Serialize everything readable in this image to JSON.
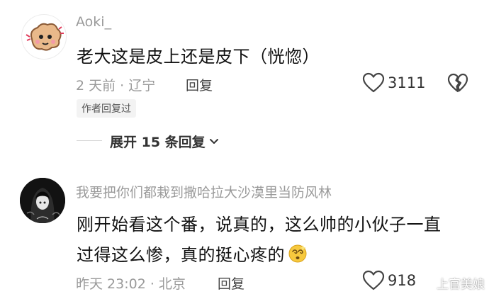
{
  "comments": [
    {
      "username": "Aoki_",
      "content": "老大这是皮上还是皮下（恍惚）",
      "time_location": "2 天前 · 辽宁",
      "reply_label": "回复",
      "likes": "3111",
      "tag": "作者回复过",
      "expand_label": "展开 15 条回复"
    },
    {
      "username": "我要把你们都栽到撒哈拉大沙漠里当防风林",
      "content_line1": "刚开始看这个番，说真的，这么帅的小伙子一直",
      "content_line2": "过得这么惨，真的挺心疼的",
      "time_location": "昨天 23:02 · 北京",
      "reply_label": "回复",
      "likes": "918"
    }
  ],
  "watermark": "上官美娘",
  "icons": {
    "like": "heart-outline-icon",
    "dislike": "broken-heart-icon",
    "expand": "chevron-down-icon",
    "emoji": "dizzy-face-emoji"
  }
}
